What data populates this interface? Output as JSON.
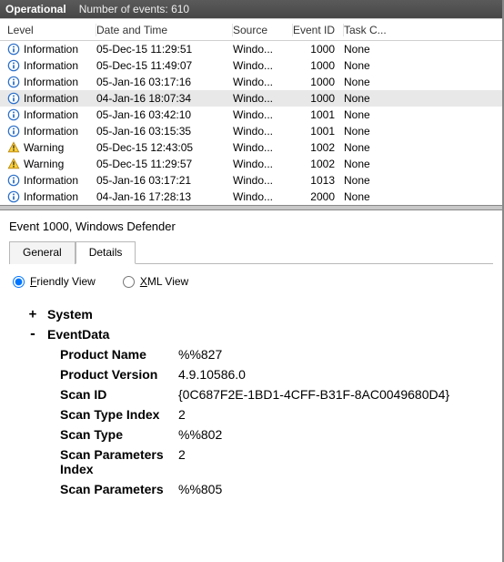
{
  "titlebar": {
    "title": "Operational",
    "count_label": "Number of events: 610"
  },
  "columns": {
    "level": "Level",
    "date": "Date and Time",
    "source": "Source",
    "event_id": "Event ID",
    "task": "Task C..."
  },
  "rows": [
    {
      "level": "Information",
      "icon": "info",
      "date": "05-Dec-15 11:29:51",
      "source": "Windo...",
      "event_id": "1000",
      "task": "None",
      "selected": false
    },
    {
      "level": "Information",
      "icon": "info",
      "date": "05-Dec-15 11:49:07",
      "source": "Windo...",
      "event_id": "1000",
      "task": "None",
      "selected": false
    },
    {
      "level": "Information",
      "icon": "info",
      "date": "05-Jan-16 03:17:16",
      "source": "Windo...",
      "event_id": "1000",
      "task": "None",
      "selected": false
    },
    {
      "level": "Information",
      "icon": "info",
      "date": "04-Jan-16 18:07:34",
      "source": "Windo...",
      "event_id": "1000",
      "task": "None",
      "selected": true
    },
    {
      "level": "Information",
      "icon": "info",
      "date": "05-Jan-16 03:42:10",
      "source": "Windo...",
      "event_id": "1001",
      "task": "None",
      "selected": false
    },
    {
      "level": "Information",
      "icon": "info",
      "date": "05-Jan-16 03:15:35",
      "source": "Windo...",
      "event_id": "1001",
      "task": "None",
      "selected": false
    },
    {
      "level": "Warning",
      "icon": "warning",
      "date": "05-Dec-15 12:43:05",
      "source": "Windo...",
      "event_id": "1002",
      "task": "None",
      "selected": false
    },
    {
      "level": "Warning",
      "icon": "warning",
      "date": "05-Dec-15 11:29:57",
      "source": "Windo...",
      "event_id": "1002",
      "task": "None",
      "selected": false
    },
    {
      "level": "Information",
      "icon": "info",
      "date": "05-Jan-16 03:17:21",
      "source": "Windo...",
      "event_id": "1013",
      "task": "None",
      "selected": false
    },
    {
      "level": "Information",
      "icon": "info",
      "date": "04-Jan-16 17:28:13",
      "source": "Windo...",
      "event_id": "2000",
      "task": "None",
      "selected": false
    }
  ],
  "detail": {
    "title": "Event 1000, Windows Defender",
    "tabs": {
      "general": "General",
      "details": "Details"
    },
    "views": {
      "friendly": "Friendly View",
      "xml": "XML View"
    },
    "nodes": {
      "system": "System",
      "eventdata": "EventData"
    },
    "eventdata": [
      {
        "k": "Product Name",
        "v": "%%827"
      },
      {
        "k": "Product Version",
        "v": "4.9.10586.0"
      },
      {
        "k": "Scan ID",
        "v": "{0C687F2E-1BD1-4CFF-B31F-8AC0049680D4}"
      },
      {
        "k": "Scan Type Index",
        "v": "2"
      },
      {
        "k": "Scan Type",
        "v": "%%802"
      },
      {
        "k": "Scan Parameters Index",
        "v": "2"
      },
      {
        "k": "Scan Parameters",
        "v": "%%805"
      }
    ]
  }
}
